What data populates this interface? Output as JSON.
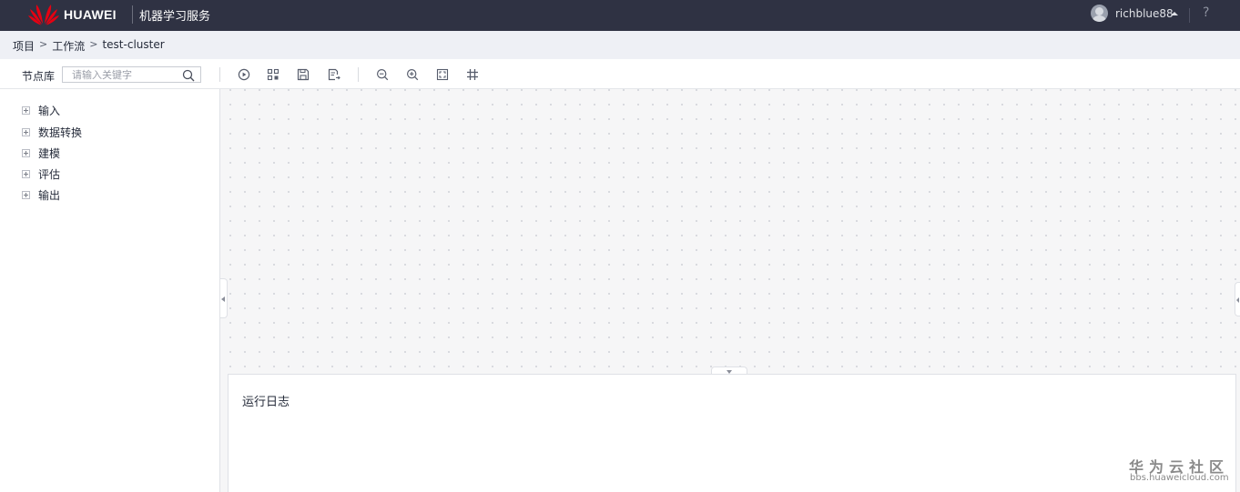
{
  "topbar": {
    "brand": "HUAWEI",
    "service": "机器学习服务",
    "username": "richblue88",
    "help": "?"
  },
  "breadcrumb": {
    "items": [
      "项目",
      "工作流",
      "test-cluster"
    ],
    "separator": ">"
  },
  "toolbar": {
    "library_label": "节点库",
    "search_placeholder": "请输入关键字",
    "search_value": "",
    "buttons": [
      {
        "name": "run",
        "icon": "play-circle-icon"
      },
      {
        "name": "auto-layout",
        "icon": "layout-icon"
      },
      {
        "name": "save",
        "icon": "save-icon"
      },
      {
        "name": "export",
        "icon": "export-icon"
      },
      {
        "name": "zoom-out",
        "icon": "zoom-out-icon"
      },
      {
        "name": "zoom-in",
        "icon": "zoom-in-icon"
      },
      {
        "name": "fit-view",
        "icon": "fit-view-icon"
      },
      {
        "name": "grid",
        "icon": "grid-icon"
      }
    ]
  },
  "node_library": {
    "items": [
      {
        "label": "输入"
      },
      {
        "label": "数据转换"
      },
      {
        "label": "建模"
      },
      {
        "label": "评估"
      },
      {
        "label": "输出"
      }
    ]
  },
  "log_panel": {
    "title": "运行日志"
  },
  "watermark": {
    "text": "华为云社区",
    "url": "bbs.huaweicloud.com"
  },
  "colors": {
    "topbar_bg": "#2f3243",
    "breadcrumb_bg": "#eef0f5",
    "canvas_bg": "#f6f6f7",
    "logo_red": "#e60012"
  }
}
